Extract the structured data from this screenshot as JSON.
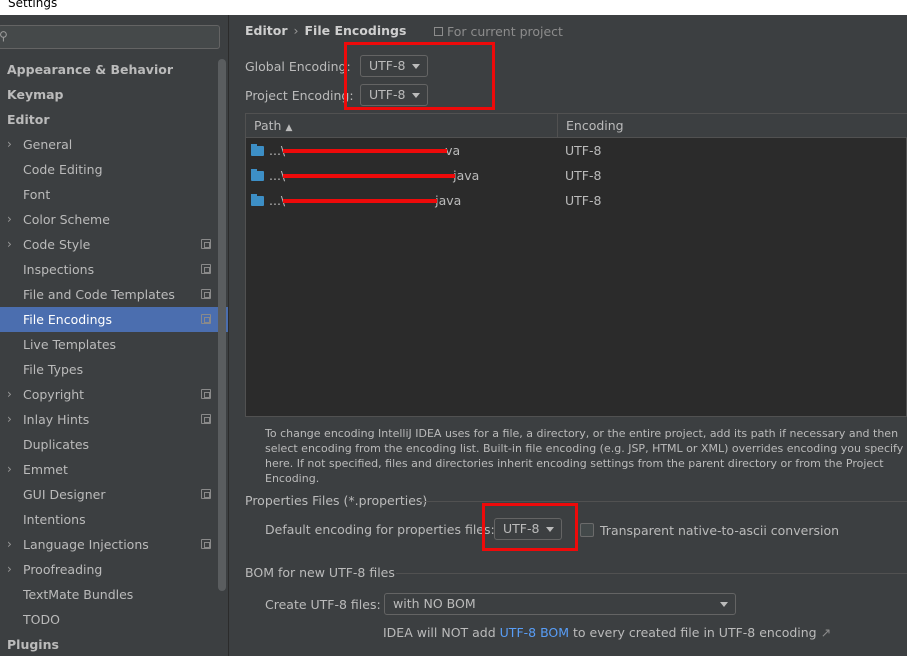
{
  "window": {
    "title": "Settings"
  },
  "sidebar": {
    "items": [
      {
        "label": "Appearance & Behavior",
        "level": 0,
        "arrow": false,
        "proj": false,
        "selected": false
      },
      {
        "label": "Keymap",
        "level": 0,
        "arrow": false,
        "proj": false,
        "selected": false
      },
      {
        "label": "Editor",
        "level": 0,
        "arrow": false,
        "proj": false,
        "selected": false
      },
      {
        "label": "General",
        "level": 1,
        "arrow": true,
        "proj": false,
        "selected": false
      },
      {
        "label": "Code Editing",
        "level": 1,
        "arrow": false,
        "proj": false,
        "selected": false
      },
      {
        "label": "Font",
        "level": 1,
        "arrow": false,
        "proj": false,
        "selected": false
      },
      {
        "label": "Color Scheme",
        "level": 1,
        "arrow": true,
        "proj": false,
        "selected": false
      },
      {
        "label": "Code Style",
        "level": 1,
        "arrow": true,
        "proj": true,
        "selected": false
      },
      {
        "label": "Inspections",
        "level": 1,
        "arrow": false,
        "proj": true,
        "selected": false
      },
      {
        "label": "File and Code Templates",
        "level": 1,
        "arrow": false,
        "proj": true,
        "selected": false
      },
      {
        "label": "File Encodings",
        "level": 1,
        "arrow": false,
        "proj": true,
        "selected": true
      },
      {
        "label": "Live Templates",
        "level": 1,
        "arrow": false,
        "proj": false,
        "selected": false
      },
      {
        "label": "File Types",
        "level": 1,
        "arrow": false,
        "proj": false,
        "selected": false
      },
      {
        "label": "Copyright",
        "level": 1,
        "arrow": true,
        "proj": true,
        "selected": false
      },
      {
        "label": "Inlay Hints",
        "level": 1,
        "arrow": true,
        "proj": true,
        "selected": false
      },
      {
        "label": "Duplicates",
        "level": 1,
        "arrow": false,
        "proj": false,
        "selected": false
      },
      {
        "label": "Emmet",
        "level": 1,
        "arrow": true,
        "proj": false,
        "selected": false
      },
      {
        "label": "GUI Designer",
        "level": 1,
        "arrow": false,
        "proj": true,
        "selected": false
      },
      {
        "label": "Intentions",
        "level": 1,
        "arrow": false,
        "proj": false,
        "selected": false
      },
      {
        "label": "Language Injections",
        "level": 1,
        "arrow": true,
        "proj": true,
        "selected": false
      },
      {
        "label": "Proofreading",
        "level": 1,
        "arrow": true,
        "proj": false,
        "selected": false
      },
      {
        "label": "TextMate Bundles",
        "level": 1,
        "arrow": false,
        "proj": false,
        "selected": false
      },
      {
        "label": "TODO",
        "level": 1,
        "arrow": false,
        "proj": false,
        "selected": false
      },
      {
        "label": "Plugins",
        "level": 0,
        "arrow": false,
        "proj": false,
        "selected": false
      }
    ]
  },
  "breadcrumb": {
    "parent": "Editor",
    "separator": "›",
    "current": "File Encodings"
  },
  "scope_note": "For current project",
  "encodings": {
    "global_label": "Global Encoding:",
    "global_value": "UTF-8",
    "project_label": "Project Encoding:",
    "project_value": "UTF-8"
  },
  "table": {
    "columns": [
      "Path",
      "Encoding"
    ],
    "sort_indicator": "▲",
    "rows": [
      {
        "path_prefix": "...\\",
        "path_suffix": "va",
        "encoding": "UTF-8"
      },
      {
        "path_prefix": "...\\",
        "path_suffix": "java",
        "encoding": "UTF-8"
      },
      {
        "path_prefix": "...\\",
        "path_suffix": "java",
        "encoding": "UTF-8"
      }
    ]
  },
  "hint": "To change encoding IntelliJ IDEA uses for a file, a directory, or the entire project, add its path if necessary and then select encoding from the encoding list. Built-in file encoding (e.g. JSP, HTML or XML) overrides encoding you specify here. If not specified, files and directories inherit encoding settings from the parent directory or from the Project Encoding.",
  "properties": {
    "section_title": "Properties Files (*.properties)",
    "default_label": "Default encoding for properties files:",
    "default_value": "UTF-8",
    "transparent_label": "Transparent native-to-ascii conversion",
    "transparent_checked": false
  },
  "bom": {
    "section_title": "BOM for new UTF-8 files",
    "create_label": "Create UTF-8 files:",
    "create_value": "with NO BOM",
    "note_prefix": "IDEA will NOT add ",
    "note_link": "UTF-8 BOM",
    "note_suffix": " to every created file in UTF-8 encoding",
    "ext_arrow": "↗"
  },
  "colors": {
    "background": "#3c3f41",
    "selection": "#4b6eaf",
    "annotation_red": "#ee0a0a",
    "link": "#589df6",
    "folder": "#3d8fc6"
  }
}
